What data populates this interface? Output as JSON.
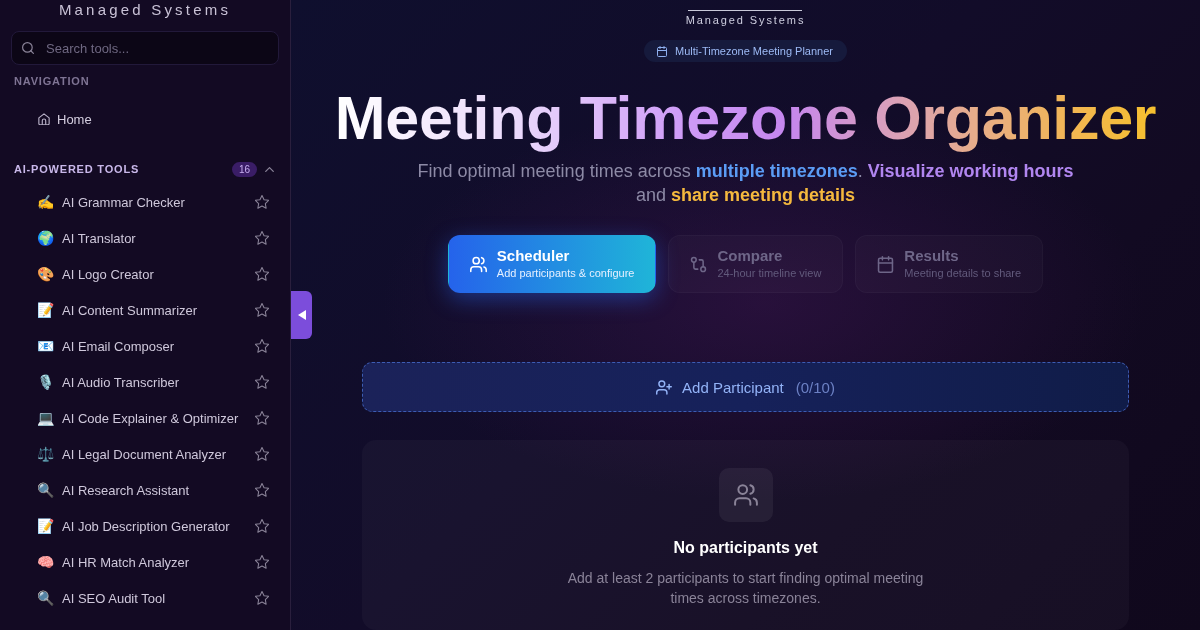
{
  "sidebar": {
    "brand": "Managed Systems",
    "search": {
      "placeholder": "Search tools..."
    },
    "navigation": {
      "heading": "NAVIGATION",
      "items": [
        {
          "label": "Home"
        }
      ]
    },
    "tools": {
      "heading": "AI-POWERED TOOLS",
      "count": "16",
      "expanded": true,
      "items": [
        {
          "icon": "✍️",
          "label": "AI Grammar Checker",
          "favorite": false
        },
        {
          "icon": "🌍",
          "label": "AI Translator",
          "favorite": false
        },
        {
          "icon": "🎨",
          "label": "AI Logo Creator",
          "favorite": false
        },
        {
          "icon": "📝",
          "label": "AI Content Summarizer",
          "favorite": false
        },
        {
          "icon": "📧",
          "label": "AI Email Composer",
          "favorite": false
        },
        {
          "icon": "🎙️",
          "label": "AI Audio Transcriber",
          "favorite": false
        },
        {
          "icon": "💻",
          "label": "AI Code Explainer & Optimizer",
          "favorite": false
        },
        {
          "icon": "⚖️",
          "label": "AI Legal Document Analyzer",
          "favorite": false
        },
        {
          "icon": "🔍",
          "label": "AI Research Assistant",
          "favorite": false
        },
        {
          "icon": "📝",
          "label": "AI Job Description Generator",
          "favorite": false
        },
        {
          "icon": "🧠",
          "label": "AI HR Match Analyzer",
          "favorite": false
        },
        {
          "icon": "🔍",
          "label": "AI SEO Audit Tool",
          "favorite": false
        }
      ]
    }
  },
  "header": {
    "logo_subtitle": "Managed Systems",
    "badge": "Multi-Timezone Meeting Planner",
    "title": "Meeting Timezone Organizer",
    "subtitle": [
      {
        "text": "Find optimal meeting times across "
      },
      {
        "text": "multiple timezones",
        "color": "#5b9cf5"
      },
      {
        "text": ". "
      },
      {
        "text": "Visualize working hours",
        "color": "#b186f0"
      },
      {
        "text": " and "
      },
      {
        "text": "share meeting details",
        "color": "#f5b93e"
      }
    ]
  },
  "steps": [
    {
      "title": "Scheduler",
      "subtitle": "Add participants & configure",
      "selected": true
    },
    {
      "title": "Compare",
      "subtitle": "24-hour timeline view",
      "selected": false
    },
    {
      "title": "Results",
      "subtitle": "Meeting details to share",
      "selected": false
    }
  ],
  "add_participant": {
    "label": "Add Participant",
    "count": "(0/10)"
  },
  "empty_state": {
    "title": "No participants yet",
    "message": "Add at least 2 participants to start finding optimal meeting times across timezones."
  }
}
